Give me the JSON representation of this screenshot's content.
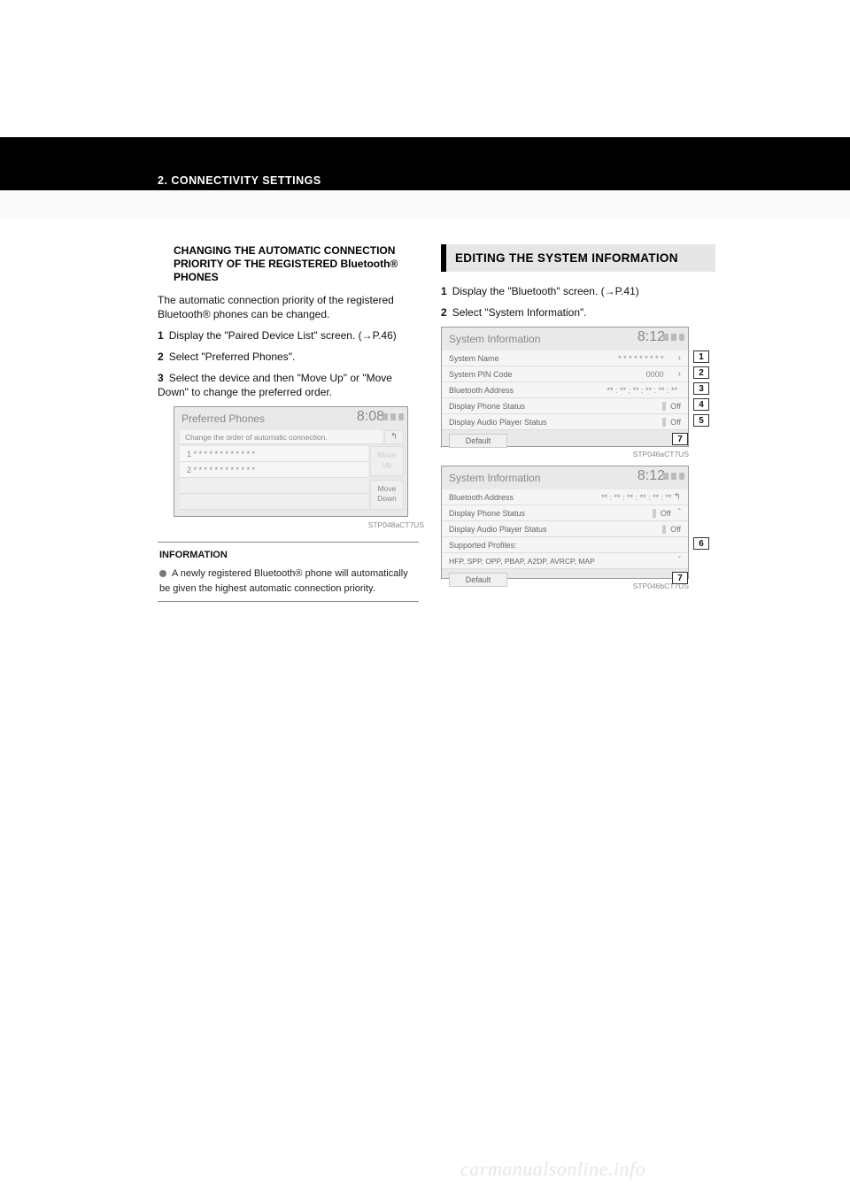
{
  "chapter": "2.  CONNECTIVITY SETTINGS",
  "left": {
    "bullet_title": "CHANGING THE AUTOMATIC CONNECTION PRIORITY OF THE REGISTERED Bluetooth® PHONES",
    "intro": "The automatic connection priority of the registered Bluetooth® phones can be changed.",
    "step1_num": "1",
    "step1": "Display the \"Paired Device List\" screen.",
    "ref1": "(→P.46)",
    "step2_num": "2",
    "step2": "Select \"Preferred Phones\".",
    "step3_num": "3",
    "step3": "Select the device and then \"Move Up\" or \"Move Down\" to change the preferred order.",
    "shot": {
      "title": "Preferred Phones",
      "time": "8:08",
      "sub": "Change the order of automatic connection.",
      "row1": "1   * * * * * * * * * * * *",
      "row2": "2   * * * * * * * * * * * *",
      "moveup": "Move\nUp",
      "movedown": "Move\nDown",
      "back": "↰"
    },
    "imgid1": "STP048aCT7US",
    "info_bullet": "A newly registered Bluetooth® phone will automatically be given the highest automatic connection priority."
  },
  "right": {
    "heading": "EDITING THE SYSTEM INFORMATION",
    "step1_num": "1",
    "step1": "Display the \"Bluetooth\" screen.",
    "ref1": "(→P.41)",
    "step2_num": "2",
    "step2": "Select \"System Information\".",
    "shotA": {
      "title": "System Information",
      "time": "8:12",
      "rows": [
        {
          "label": "System Name",
          "value": "* * * * * * * * *",
          "type": "arrow",
          "cal": "1"
        },
        {
          "label": "System PIN Code",
          "value": "0000",
          "type": "arrow",
          "cal": "2"
        },
        {
          "label": "Bluetooth Address",
          "value": "** : ** : ** : ** : ** : **",
          "type": "",
          "cal": "3"
        },
        {
          "label": "Display Phone Status",
          "value": "Off",
          "type": "toggle",
          "cal": "4"
        },
        {
          "label": "Display Audio Player Status",
          "value": "Off",
          "type": "toggle",
          "cal": "5"
        }
      ],
      "default": "Default",
      "defCal": "7"
    },
    "imgidA": "STP046aCT7US",
    "shotB": {
      "title": "System Information",
      "time": "8:12",
      "rows": [
        {
          "label": "Bluetooth Address",
          "value": "** : ** : ** : ** : ** : **",
          "type": "back",
          "cal": ""
        },
        {
          "label": "Display Phone Status",
          "value": "Off",
          "type": "toggle-up",
          "cal": ""
        },
        {
          "label": "Display Audio Player Status",
          "value": "Off",
          "type": "toggle",
          "cal": ""
        },
        {
          "label": "Supported Profiles:",
          "value": "",
          "type": "dn",
          "cal": "6"
        },
        {
          "label": "HFP, SPP, OPP, PBAP, A2DP, AVRCP, MAP",
          "value": "",
          "type": "dn2",
          "cal": ""
        }
      ],
      "default": "Default",
      "defCal": "7"
    },
    "imgidB": "STP046bCT7US"
  },
  "watermark": "carmanualsonline.info"
}
